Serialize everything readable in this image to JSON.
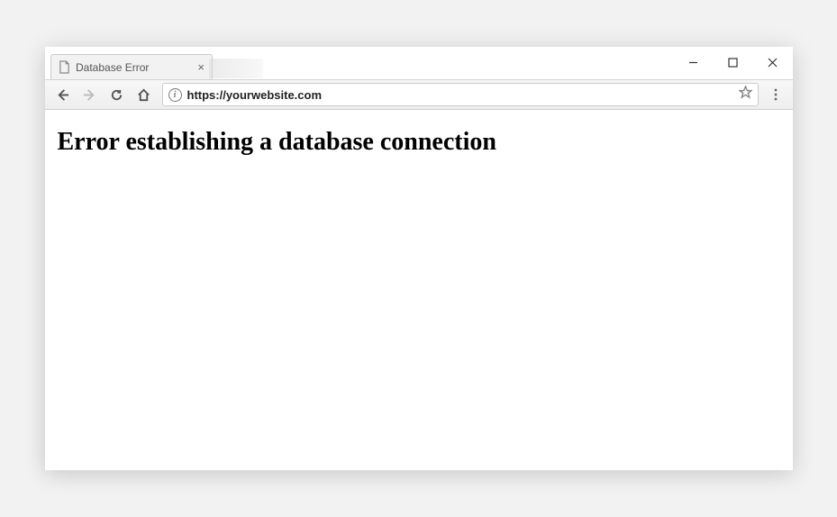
{
  "tab": {
    "title": "Database Error"
  },
  "address_bar": {
    "url": "https://yourwebsite.com"
  },
  "page": {
    "heading": "Error establishing a database connection"
  }
}
